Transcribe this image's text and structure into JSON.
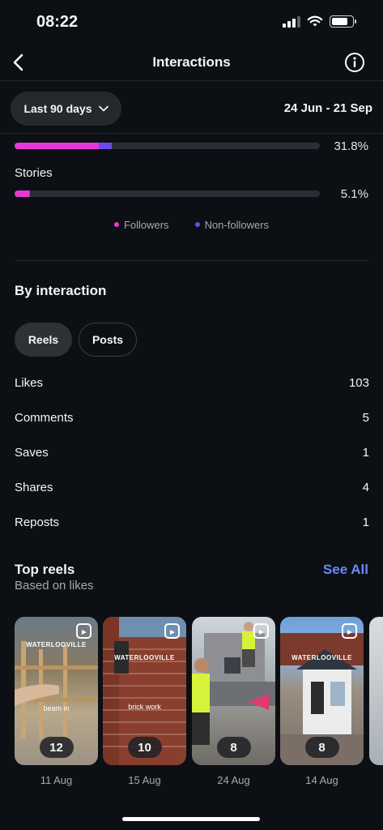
{
  "status_bar": {
    "time": "08:22"
  },
  "header": {
    "title": "Interactions"
  },
  "filter": {
    "range_label": "Last 90 days",
    "date_range": "24 Jun - 21 Sep"
  },
  "bars": [
    {
      "label": "",
      "followers_pct": 31.8,
      "followers_fill": 0.277,
      "nonfollowers_fill": 0.041,
      "value": "31.8%"
    },
    {
      "label": "Stories",
      "followers_pct": 5.1,
      "followers_fill": 0.047,
      "nonfollowers_fill": 0.004,
      "value": "5.1%"
    }
  ],
  "legend": {
    "followers": "Followers",
    "non_followers": "Non-followers"
  },
  "colors": {
    "followers": "#e838d6",
    "non_followers": "#6a4de8",
    "link": "#6b8af7"
  },
  "by_interaction": {
    "title": "By interaction",
    "tabs": [
      "Reels",
      "Posts"
    ],
    "metrics": [
      {
        "label": "Likes",
        "value": "103"
      },
      {
        "label": "Comments",
        "value": "5"
      },
      {
        "label": "Saves",
        "value": "1"
      },
      {
        "label": "Shares",
        "value": "4"
      },
      {
        "label": "Reposts",
        "value": "1"
      }
    ]
  },
  "top_reels": {
    "title": "Top reels",
    "see_all": "See All",
    "subtitle": "Based on likes",
    "items": [
      {
        "count": "12",
        "date": "11 Aug",
        "brand_text": "WATERLOOVILLE",
        "caption": "beam in"
      },
      {
        "count": "10",
        "date": "15 Aug",
        "brand_text": "WATERLOOVILLE",
        "caption": "brick work"
      },
      {
        "count": "8",
        "date": "24 Aug",
        "brand_text": "",
        "caption": ""
      },
      {
        "count": "8",
        "date": "14 Aug",
        "brand_text": "WATERLOOVILLE",
        "caption": ""
      }
    ]
  }
}
